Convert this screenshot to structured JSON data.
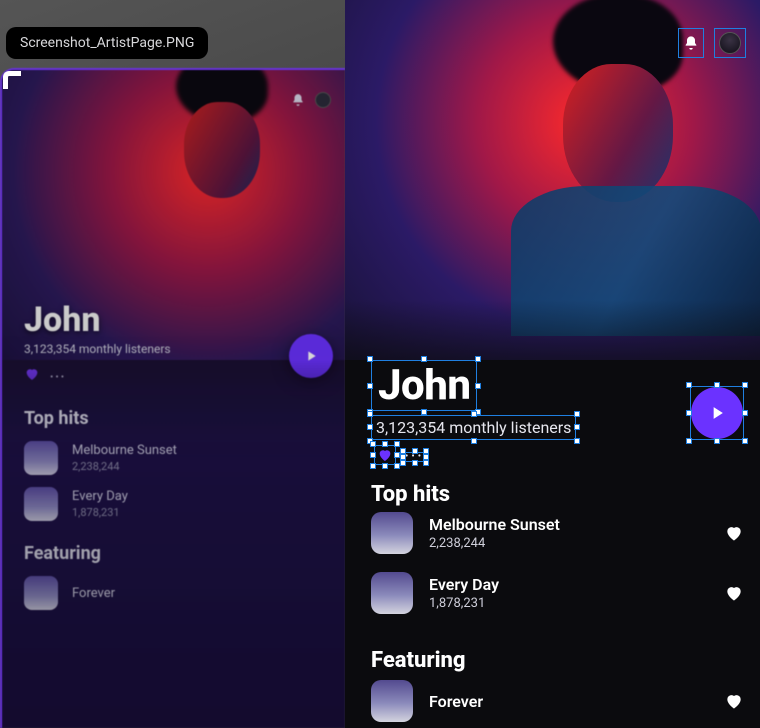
{
  "designer": {
    "filename_chip": "Screenshot_ArtistPage.PNG"
  },
  "artist": {
    "name": "John",
    "monthly_listeners_label": "3,123,354 monthly listeners"
  },
  "sections": {
    "top_hits_title": "Top hits",
    "featuring_title": "Featuring"
  },
  "top_hits": [
    {
      "title": "Melbourne Sunset",
      "plays": "2,238,244"
    },
    {
      "title": "Every Day",
      "plays": "1,878,231"
    }
  ],
  "featuring": [
    {
      "title": "Forever"
    }
  ],
  "colors": {
    "accent_purple": "#6b32ff",
    "selection_blue": "#1f7fe0"
  }
}
